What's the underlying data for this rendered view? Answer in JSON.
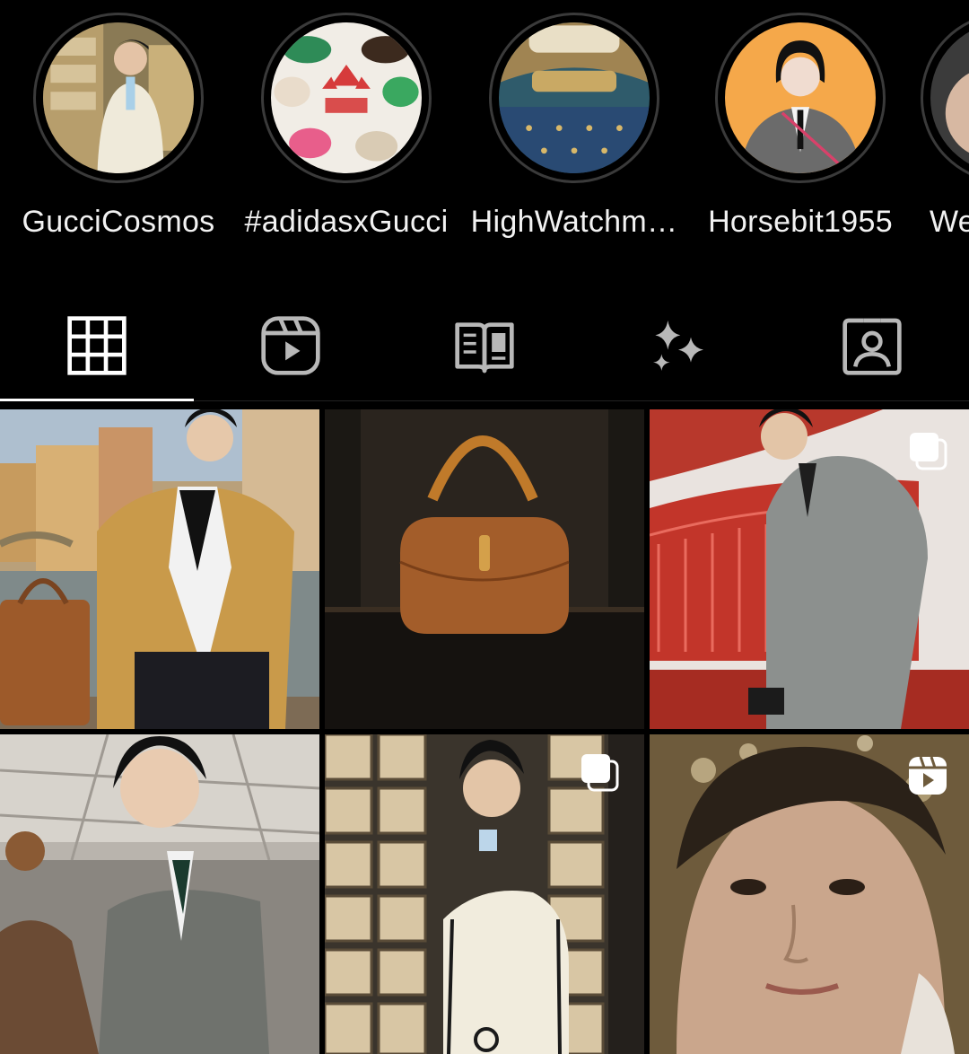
{
  "highlights": [
    {
      "label": "GucciCosmos"
    },
    {
      "label": "#adidasxGucci"
    },
    {
      "label": "HighWatchm…"
    },
    {
      "label": "Horsebit1955"
    },
    {
      "label": "We"
    }
  ],
  "tabs": [
    {
      "name": "posts-grid-icon",
      "active": true
    },
    {
      "name": "reels-icon",
      "active": false
    },
    {
      "name": "guides-icon",
      "active": false
    },
    {
      "name": "effects-icon",
      "active": false
    },
    {
      "name": "tagged-icon",
      "active": false
    }
  ],
  "posts": [
    {
      "subject": "man in plaid jacket with bag by river",
      "badge": "none"
    },
    {
      "subject": "brown bamboo handle bag",
      "badge": "none"
    },
    {
      "subject": "man in grey suit on red staircase",
      "badge": "multiple-icon"
    },
    {
      "subject": "man in grey suit holding hat",
      "badge": "none"
    },
    {
      "subject": "man in cream jacket by shelves",
      "badge": "multiple-icon"
    },
    {
      "subject": "close-up portrait",
      "badge": "reel-icon"
    }
  ],
  "colors": {
    "background": "#000000",
    "text": "#f2f2f2",
    "icon_active": "#ffffff",
    "icon_inactive": "#b8b8b8",
    "ring": "#3a3a3a"
  }
}
